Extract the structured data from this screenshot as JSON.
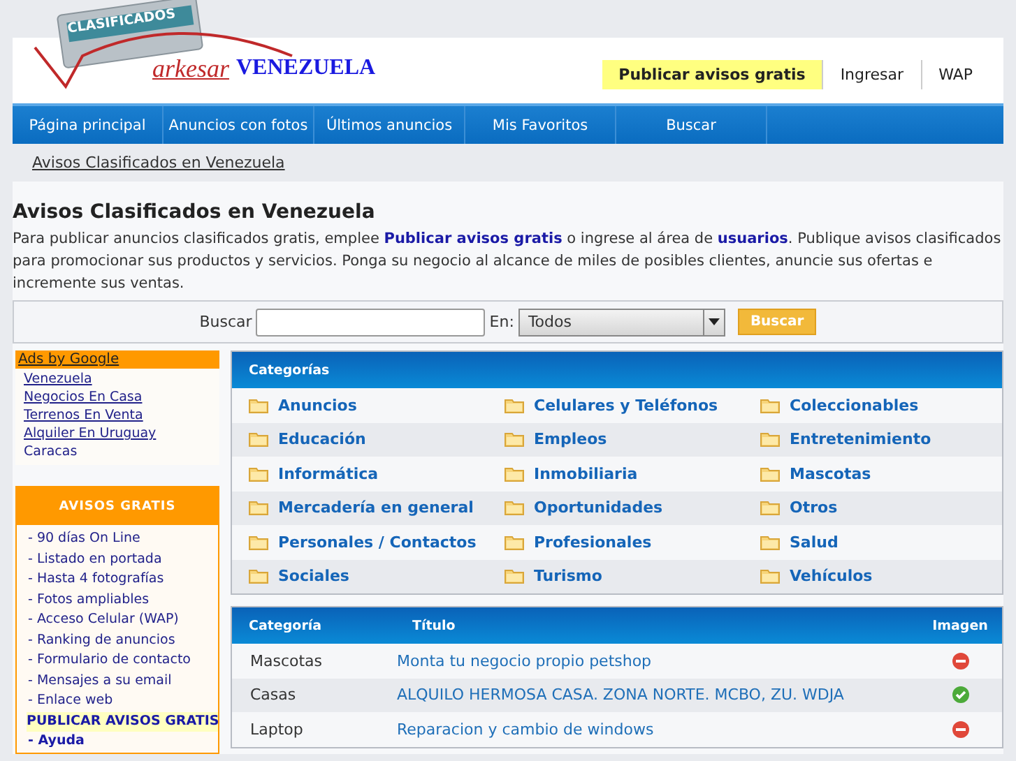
{
  "logo": {
    "badge": "CLASIFICADOS",
    "brand": "arkesar",
    "country": "VENEZUELA"
  },
  "top_links": [
    {
      "label": "Publicar avisos gratis",
      "highlighted": true
    },
    {
      "label": "Ingresar",
      "highlighted": false
    },
    {
      "label": "WAP",
      "highlighted": false
    }
  ],
  "nav": [
    "Página principal",
    "Anuncios con fotos",
    "Últimos anuncios",
    "Mis Favoritos",
    "Buscar"
  ],
  "breadcrumb": "Avisos Clasificados en Venezuela",
  "heading": "Avisos Clasificados en Venezuela",
  "intro": {
    "before": "Para publicar anuncios clasificados gratis, emplee ",
    "link1": "Publicar avisos gratis",
    "middle": " o ingrese al área de ",
    "link2": "usuarios",
    "after": ". Publique avisos clasificados para promocionar sus productos y servicios. Ponga su negocio al alcance de miles de posibles clientes, anuncie sus ofertas e incremente sus ventas."
  },
  "search": {
    "label": "Buscar",
    "in_label": "En:",
    "select_value": "Todos",
    "button": "Buscar"
  },
  "ads": {
    "title": "Ads by Google",
    "links": [
      {
        "label": "Venezuela",
        "underlined": true
      },
      {
        "label": "Negocios En Casa",
        "underlined": true
      },
      {
        "label": "Terrenos En Venta",
        "underlined": true
      },
      {
        "label": "Alquiler En Uruguay",
        "underlined": true
      },
      {
        "label": "Caracas",
        "underlined": false
      }
    ]
  },
  "avisos_gratis": {
    "title": "AVISOS GRATIS",
    "items": [
      {
        "label": "- 90 días On Line",
        "kind": "plain"
      },
      {
        "label": "- Listado en portada",
        "kind": "plain"
      },
      {
        "label": "- Hasta 4 fotografías",
        "kind": "plain"
      },
      {
        "label": "- Fotos ampliables",
        "kind": "plain"
      },
      {
        "label": "- Acceso Celular (WAP)",
        "kind": "plain"
      },
      {
        "label": "- Ranking de anuncios",
        "kind": "plain"
      },
      {
        "label": "- Formulario de contacto",
        "kind": "plain"
      },
      {
        "label": "- Mensajes a su email",
        "kind": "plain"
      },
      {
        "label": "- Enlace web",
        "kind": "plain"
      },
      {
        "label": "PUBLICAR AVISOS GRATIS",
        "kind": "cta"
      },
      {
        "label": "- Ayuda",
        "kind": "bold"
      }
    ]
  },
  "categories": {
    "title": "Categorías",
    "items": [
      "Anuncios",
      "Celulares y Teléfonos",
      "Coleccionables",
      "Educación",
      "Empleos",
      "Entretenimiento",
      "Informática",
      "Inmobiliaria",
      "Mascotas",
      "Mercadería en general",
      "Oportunidades",
      "Otros",
      "Personales / Contactos",
      "Profesionales",
      "Salud",
      "Sociales",
      "Turismo",
      "Vehículos"
    ]
  },
  "listings": {
    "columns": [
      "Categoría",
      "Título",
      "Imagen"
    ],
    "rows": [
      {
        "category": "Mascotas",
        "title": "Monta tu negocio propio petshop",
        "has_image": false
      },
      {
        "category": "Casas",
        "title": "ALQUILO HERMOSA CASA. ZONA NORTE. MCBO, ZU. WDJA",
        "has_image": true
      },
      {
        "category": "Laptop",
        "title": "Reparacion y cambio de windows",
        "has_image": false
      }
    ]
  }
}
